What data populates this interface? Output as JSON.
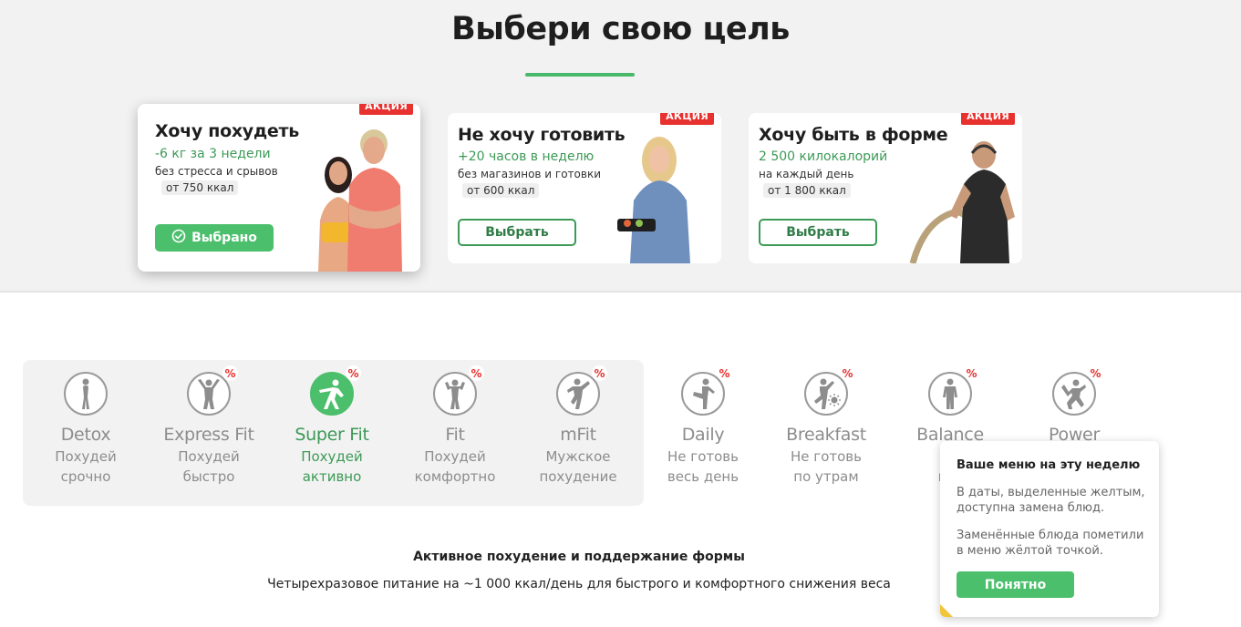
{
  "page": {
    "title": "Выбери свою цель"
  },
  "goals": [
    {
      "badge": "АКЦИЯ",
      "title": "Хочу похудеть",
      "subtitle": "-6 кг за 3 недели",
      "desc": "без стресса и срывов",
      "kcal": "от 750 ккал",
      "button": "Выбрано",
      "selected": true
    },
    {
      "badge": "АКЦИЯ",
      "title": "Не хочу готовить",
      "subtitle": "+20 часов в неделю",
      "desc": "без магазинов и готовки",
      "kcal": "от 600 ккал",
      "button": "Выбрать",
      "selected": false
    },
    {
      "badge": "АКЦИЯ",
      "title": "Хочу быть в форме",
      "subtitle": "2 500 килокалорий",
      "desc": "на каждый день",
      "kcal": "от 1 800 ккал",
      "button": "Выбрать",
      "selected": false
    }
  ],
  "programs": [
    {
      "name": "Detox",
      "line1": "Похудей",
      "line2": "срочно",
      "icon": "figure-standing-icon",
      "discount": ""
    },
    {
      "name": "Express Fit",
      "line1": "Похудей",
      "line2": "быстро",
      "icon": "figure-arms-up-icon",
      "discount": "%"
    },
    {
      "name": "Super Fit",
      "line1": "Похудей",
      "line2": "активно",
      "icon": "figure-leaning-icon",
      "discount": "%",
      "active": true
    },
    {
      "name": "Fit",
      "line1": "Похудей",
      "line2": "комфортно",
      "icon": "figure-flex-icon",
      "discount": "%"
    },
    {
      "name": "mFit",
      "line1": "Мужское",
      "line2": "похудение",
      "icon": "figure-kick-icon",
      "discount": "%"
    },
    {
      "name": "Daily",
      "line1": "Не готовь",
      "line2": "весь день",
      "icon": "figure-leg-up-icon",
      "discount": "%"
    },
    {
      "name": "Breakfast",
      "line1": "Не готовь",
      "line2": "по утрам",
      "icon": "figure-sun-icon",
      "discount": "%"
    },
    {
      "name": "Balance",
      "line1": "Б",
      "line2": "в ф",
      "icon": "figure-man-icon",
      "discount": "%"
    },
    {
      "name": "Power",
      "line1": "",
      "line2": "",
      "icon": "figure-power-icon",
      "discount": "%"
    }
  ],
  "summary": {
    "title": "Активное похудение и поддержание формы",
    "desc": "Четырехразовое питание на ~1 000 ккал/день для быстрого и комфортного снижения веса"
  },
  "popup": {
    "title": "Ваше меню на эту неделю",
    "text1": "В даты, выделенные желтым, доступна замена блюд.",
    "text2": "Заменённые блюда пометили в меню жёлтой точкой.",
    "button": "Понятно"
  },
  "colors": {
    "accent": "#4bbf6b",
    "accent_dark": "#3c9a56",
    "badge": "#e8322f",
    "highlight": "#f2c43a"
  }
}
